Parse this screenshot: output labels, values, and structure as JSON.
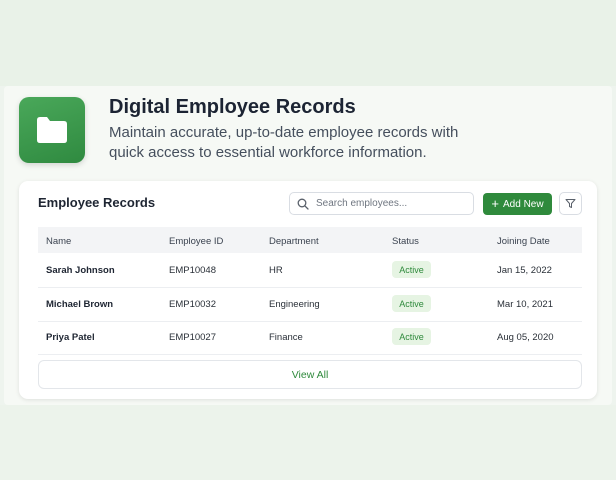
{
  "hero": {
    "title": "Digital Employee Records",
    "description": "Maintain accurate, up-to-date employee records with quick access to essential workforce information.",
    "icon": "folder-icon"
  },
  "card": {
    "title": "Employee Records",
    "search": {
      "placeholder": "Search employees...",
      "value": ""
    },
    "add_button": "Add New",
    "view_all": "View All"
  },
  "table": {
    "columns": [
      "Name",
      "Employee ID",
      "Department",
      "Status",
      "Joining Date"
    ],
    "rows": [
      {
        "name": "Sarah Johnson",
        "id": "EMP10048",
        "department": "HR",
        "status": "Active",
        "joined": "Jan 15, 2022"
      },
      {
        "name": "Michael Brown",
        "id": "EMP10032",
        "department": "Engineering",
        "status": "Active",
        "joined": "Mar 10, 2021"
      },
      {
        "name": "Priya Patel",
        "id": "EMP10027",
        "department": "Finance",
        "status": "Active",
        "joined": "Aug 05, 2020"
      }
    ]
  },
  "colors": {
    "accent": "#2f8a3c",
    "status_active_bg": "#e6f4e3",
    "page_bg": "#eef4ee"
  }
}
